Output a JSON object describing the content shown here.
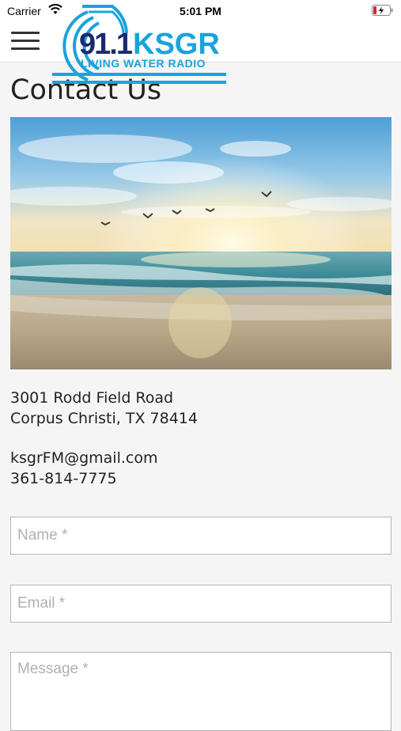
{
  "status_bar": {
    "carrier": "Carrier",
    "time": "5:01 PM"
  },
  "logo": {
    "frequency": "91.1",
    "callsign": "KSGR",
    "tagline": "LIVING WATER RADIO",
    "color": "#1aa3dd"
  },
  "page": {
    "title": "Contact Us"
  },
  "address": {
    "line1": "3001 Rodd Field Road",
    "line2": "Corpus Christi, TX 78414"
  },
  "contact": {
    "email": "ksgrFM@gmail.com",
    "phone": "361-814-7775"
  },
  "form": {
    "name_placeholder": "Name *",
    "email_placeholder": "Email *",
    "message_placeholder": "Message *"
  },
  "icons": {
    "menu": "hamburger-menu-icon",
    "wifi": "wifi-icon",
    "battery": "battery-charging-icon"
  }
}
